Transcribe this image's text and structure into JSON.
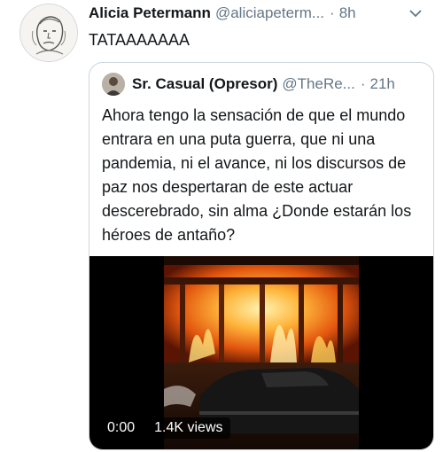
{
  "tweet": {
    "author_name": "Alicia Petermann",
    "author_handle": "@aliciapeterm...",
    "time_sep": "·",
    "time": "8h",
    "text": "TATAAAAAAA",
    "avatar_icon": "sketch-portrait-avatar",
    "menu_icon": "chevron-down-icon"
  },
  "quoted": {
    "author_name": "Sr. Casual (Opresor)",
    "author_handle": "@TheRe...",
    "time_sep": "·",
    "time": "21h",
    "text": "Ahora tengo la sensación de que el mundo entrara en una puta guerra, que ni una pandemia, ni el avance, ni los discursos de paz nos despertaran de este actuar descerebrado, sin alma ¿Donde estarán los héroes de antaño?",
    "video": {
      "duration": "0:00",
      "views": "1.4K views"
    }
  },
  "colors": {
    "text": "#14171a",
    "secondary": "#657786",
    "border": "#ccd6dd",
    "fire": "#ff8a1e"
  }
}
